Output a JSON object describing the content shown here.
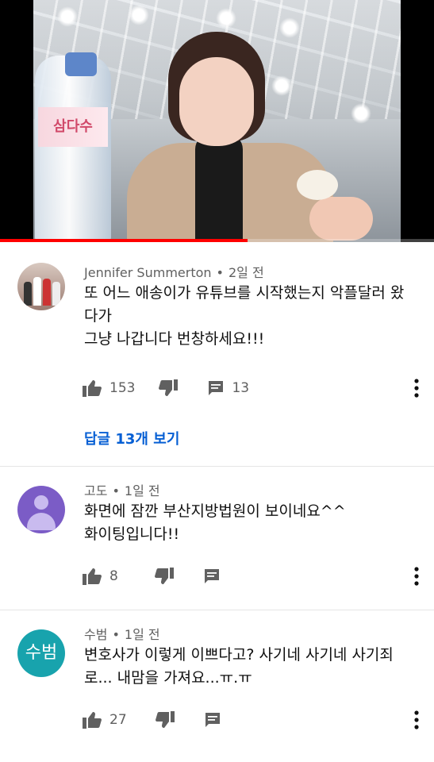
{
  "video": {
    "progress_fraction": 0.57,
    "bottle_label": "삼다수"
  },
  "comments": [
    {
      "author": "Jennifer Summerton",
      "time": "2일 전",
      "lines": [
        "또 어느 애송이가 유튜브를 시작했는지 악플달러 왔",
        "다가",
        "그냥 나갑니다 번창하세요!!!"
      ],
      "likes": "153",
      "reply_count": "13",
      "view_replies": "답글 13개 보기"
    },
    {
      "author": "고도",
      "time": "1일 전",
      "lines": [
        "화면에 잠깐 부산지방법원이 보이네요^^",
        "화이팅입니다!!"
      ],
      "likes": "8"
    },
    {
      "author": "수범",
      "avatar_text": "수범",
      "time": "1일 전",
      "lines": [
        "변호사가 이렇게 이쁘다고? 사기네 사기네 사기죄",
        "로... 내맘을 가져요...ㅠ.ㅠ"
      ],
      "likes": "27"
    }
  ],
  "separator": "•",
  "colors": {
    "link": "#065fd4",
    "progress": "#ff0000",
    "avatar_purple": "#7b5cc6",
    "avatar_teal": "#18a3ad"
  }
}
